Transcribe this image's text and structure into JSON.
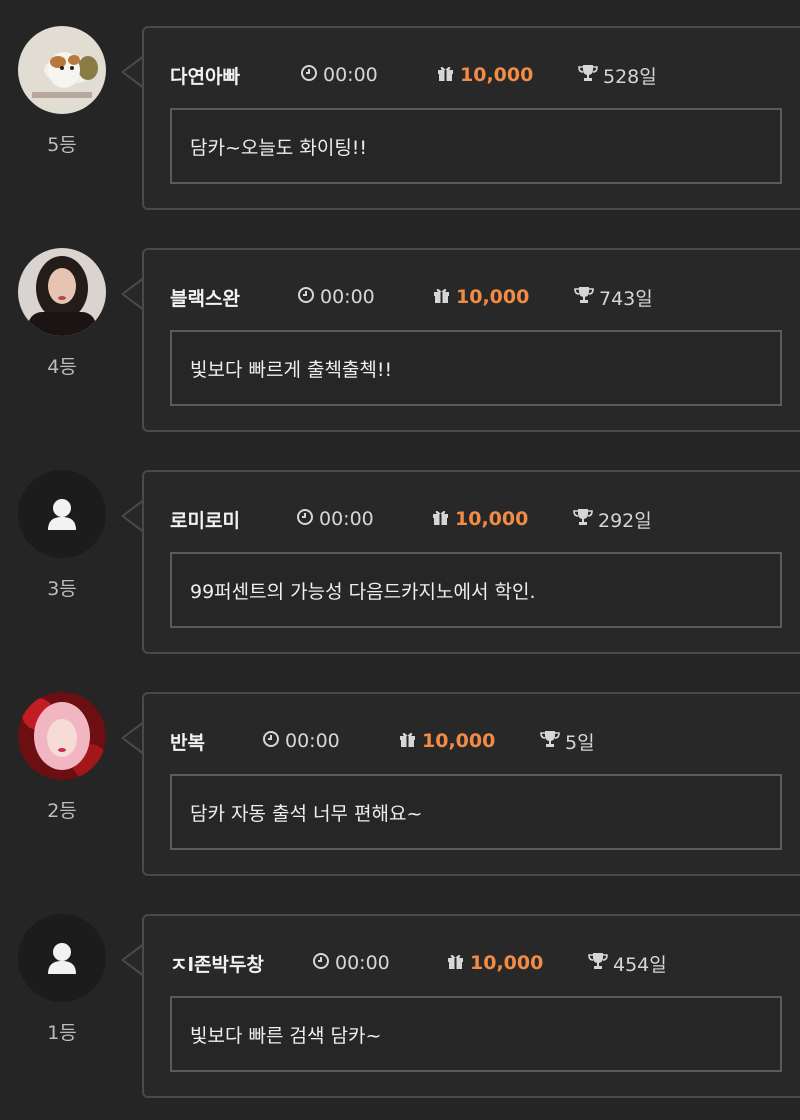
{
  "comments": [
    {
      "rank": "5등",
      "nickname": "다연아빠",
      "time": "00:00",
      "points": "10,000",
      "days": "528일",
      "message": "담카~오늘도 화이팅!!",
      "avatar": "hamster-photo"
    },
    {
      "rank": "4등",
      "nickname": "블랙스완",
      "time": "00:00",
      "points": "10,000",
      "days": "743일",
      "message": "빛보다 빠르게 출첵출첵!!",
      "avatar": "woman-portrait-photo"
    },
    {
      "rank": "3등",
      "nickname": "로미로미",
      "time": "00:00",
      "points": "10,000",
      "days": "292일",
      "message": "99퍼센트의 가능성 다음드카지노에서 학인.",
      "avatar": "default-user"
    },
    {
      "rank": "2등",
      "nickname": "반복",
      "time": "00:00",
      "points": "10,000",
      "days": "5일",
      "message": "담카 자동 출석 너무 편해요~",
      "avatar": "pink-hair-portrait-photo"
    },
    {
      "rank": "1등",
      "nickname": "ㅈl존박두창",
      "time": "00:00",
      "points": "10,000",
      "days": "454일",
      "message": "빛보다 빠른 검색 담카~",
      "avatar": "default-user"
    }
  ],
  "colors": {
    "background": "#252525",
    "points": "#f28b45",
    "border": "#4a4a4a"
  },
  "icons": {
    "time": "clock-icon",
    "points": "gift-icon",
    "days": "trophy-icon",
    "user": "user-silhouette-icon"
  }
}
